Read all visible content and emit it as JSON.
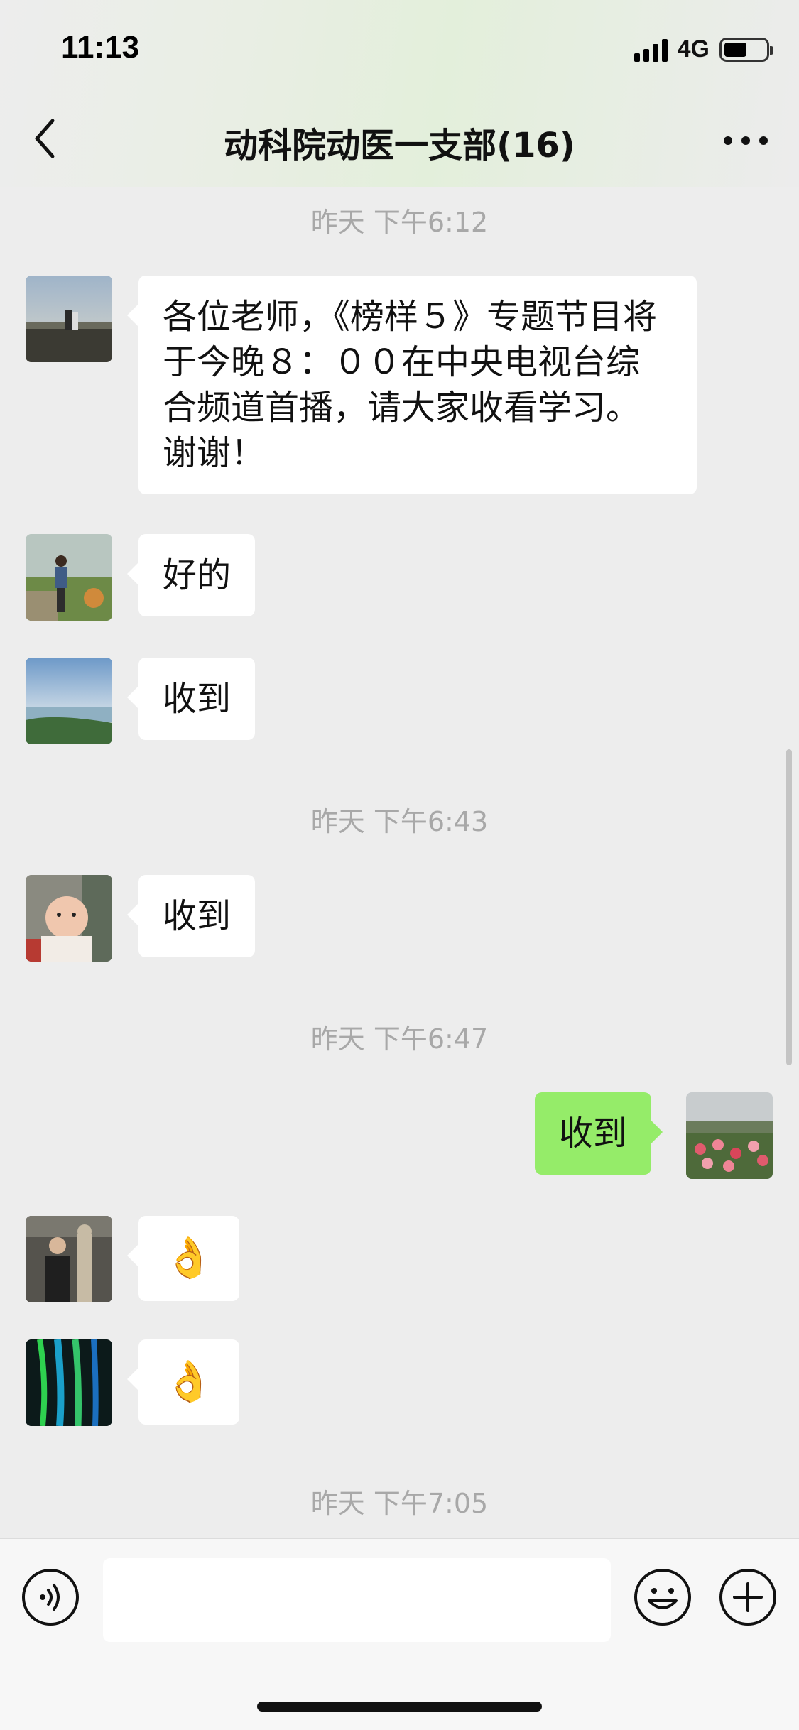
{
  "status_bar": {
    "time": "11:13",
    "network": "4G",
    "battery_level": 0.55
  },
  "header": {
    "title": "动科院动医一支部(16)"
  },
  "timestamps": [
    "昨天 下午6:12",
    "昨天 下午6:43",
    "昨天 下午6:47",
    "昨天 下午7:05"
  ],
  "messages": [
    {
      "side": "left",
      "text": "各位老师，《榜样５》专题节目将于今晚８：００在中央电视台综合频道首播，请大家收看学习。谢谢！"
    },
    {
      "side": "left",
      "text": "好的"
    },
    {
      "side": "left",
      "text": "收到"
    },
    {
      "side": "left",
      "text": "收到"
    },
    {
      "side": "right",
      "text": "收到"
    },
    {
      "side": "left",
      "text": "👌"
    },
    {
      "side": "left",
      "text": "👌"
    }
  ],
  "input": {
    "value": ""
  },
  "colors": {
    "sent_bubble": "#95ec69",
    "received_bubble": "#ffffff",
    "background": "#ededed",
    "timestamp": "#a8a8a8"
  },
  "icons": [
    "chevron-left-icon",
    "more-icon",
    "voice-icon",
    "emoji-icon",
    "plus-icon"
  ]
}
